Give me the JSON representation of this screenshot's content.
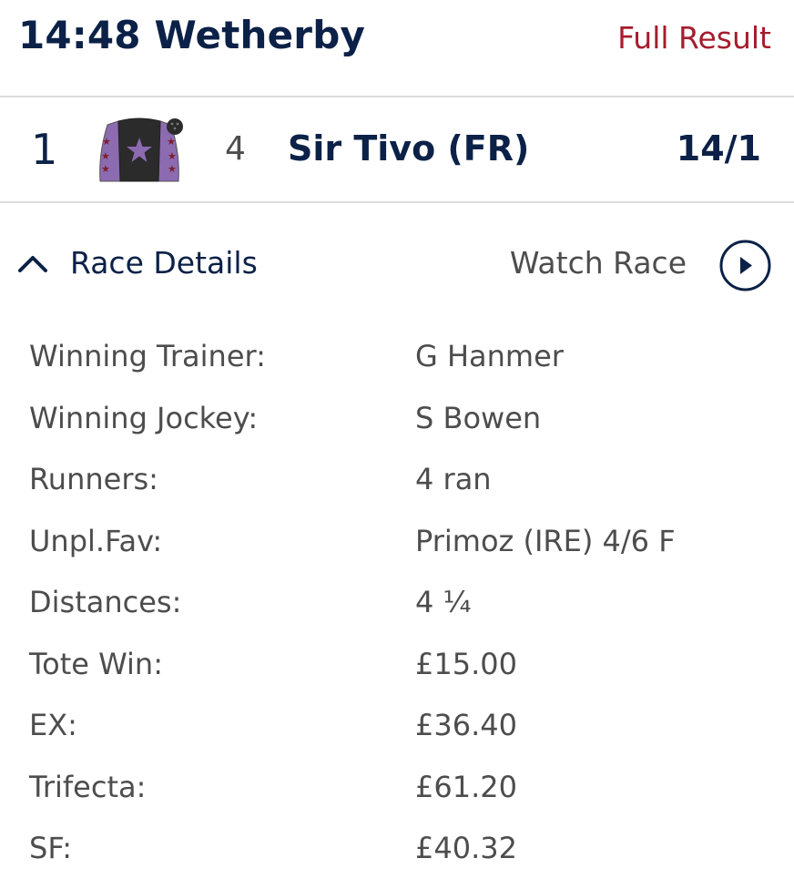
{
  "header": {
    "race_title": "14:48 Wetherby",
    "full_result_label": "Full Result"
  },
  "winner": {
    "position": "1",
    "silks_icon": "jockey-silks-icon",
    "cloth_number": "4",
    "horse_name": "Sir Tivo (FR)",
    "odds": "14/1",
    "silks_colors": {
      "body": "#2b2b2b",
      "star": "#8c6bb1",
      "sleeves": "#8c6bb1",
      "sleeve_stars": "#7a1f2b",
      "cap": "#2b2b2b"
    }
  },
  "details_bar": {
    "toggle_icon": "chevron-up-icon",
    "label": "Race Details",
    "watch_label": "Watch Race",
    "watch_icon": "play-circle-icon"
  },
  "race_details": [
    {
      "key": "Winning Trainer:",
      "value": "G Hanmer"
    },
    {
      "key": "Winning Jockey:",
      "value": "S Bowen"
    },
    {
      "key": "Runners:",
      "value": "4 ran"
    },
    {
      "key": "Unpl.Fav:",
      "value": "Primoz (IRE) 4/6 F"
    },
    {
      "key": "Distances:",
      "value": "4 ¼"
    },
    {
      "key": "Tote Win:",
      "value": "£15.00"
    },
    {
      "key": "EX:",
      "value": "£36.40"
    },
    {
      "key": "Trifecta:",
      "value": "£61.20"
    },
    {
      "key": "SF:",
      "value": "£40.32"
    }
  ],
  "colors": {
    "navy": "#0b2147",
    "accent_red": "#a51d2d",
    "text_grey": "#4d4d4d",
    "divider": "#dcdcdc"
  }
}
